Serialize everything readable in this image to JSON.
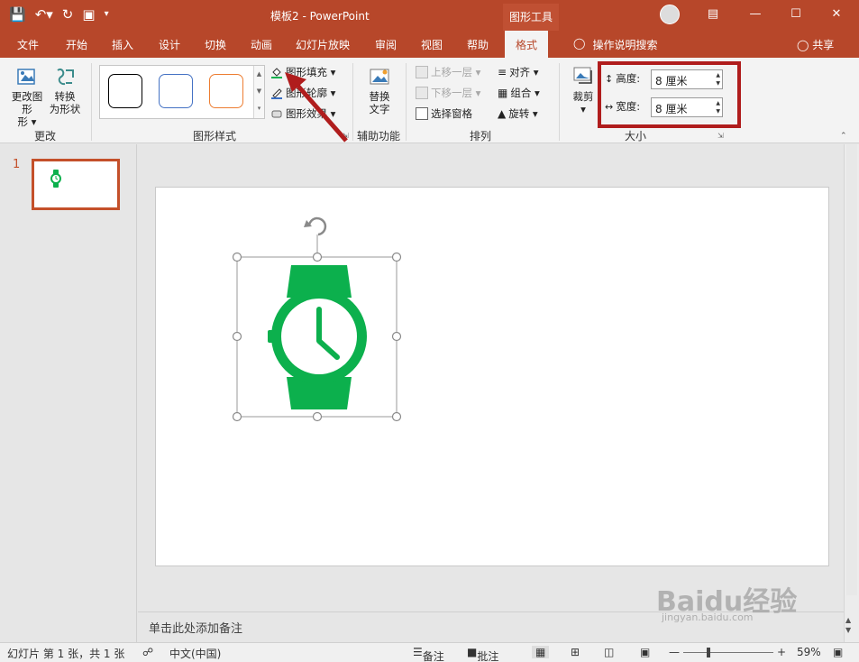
{
  "window": {
    "title": "模板2 - PowerPoint",
    "tool_context": "图形工具",
    "accent": "#b7472a"
  },
  "tabs": [
    "文件",
    "开始",
    "插入",
    "设计",
    "切换",
    "动画",
    "幻灯片放映",
    "审阅",
    "视图",
    "帮助",
    "格式"
  ],
  "active_tab": "格式",
  "tell_me": "操作说明搜索",
  "share": "共享",
  "ribbon": {
    "change_group": {
      "label": "更改",
      "change_shape": "更改图形",
      "change_shape_l2": "形 ▾",
      "convert": "转换",
      "convert_l2": "为形状"
    },
    "styles_group": {
      "label": "图形样式",
      "fill": "图形填充 ▾",
      "outline": "图形轮廓 ▾",
      "effects": "图形效果 ▾"
    },
    "access_group": {
      "label": "辅助功能",
      "alt_text": "替换",
      "alt_text_l2": "文字"
    },
    "arrange_group": {
      "label": "排列",
      "bring_forward": "上移一层 ▾",
      "send_backward": "下移一层 ▾",
      "selection_pane": "选择窗格",
      "align": "对齐 ▾",
      "group": "组合 ▾",
      "rotate": "旋转 ▾"
    },
    "size_group": {
      "label": "大小",
      "crop": "裁剪",
      "height_label": "高度:",
      "height_value": "8 厘米",
      "width_label": "宽度:",
      "width_value": "8 厘米"
    }
  },
  "slide_pane": {
    "slide_number": "1"
  },
  "notes_placeholder": "单击此处添加备注",
  "status": {
    "slide_info": "幻灯片 第 1 张，共 1 张",
    "language": "中文(中国)",
    "notes": "备注",
    "comments": "批注",
    "zoom": "59%"
  },
  "watermark": {
    "brand": "Baidu经验",
    "url": "jingyan.baidu.com"
  },
  "colors": {
    "watch_green": "#0cb04d",
    "highlight_red": "#b01d1d",
    "swatch_borders": [
      "#000000",
      "#4472c4",
      "#ed7d31"
    ]
  }
}
